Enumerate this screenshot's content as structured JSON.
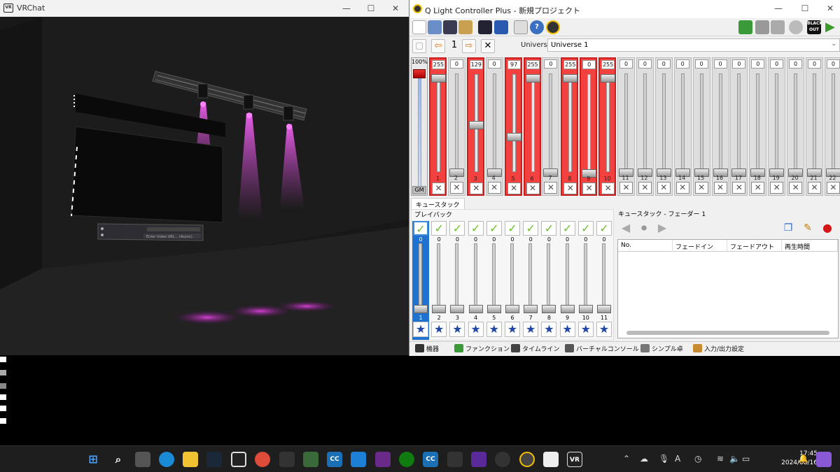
{
  "vrchat": {
    "title": "VRChat",
    "icon": "VR",
    "panel_text": "Enter Video URL... (Async)"
  },
  "qlc": {
    "title": "Q Light Controller Plus - 新規プロジェクト",
    "blackout_label": "BLACK OUT",
    "page_number": "1",
    "universe_label": "Universe",
    "universe_value": "Universe 1",
    "gm": {
      "percent": "100%",
      "label": "GM"
    },
    "channels": [
      {
        "num": "1",
        "value": "255",
        "on": true
      },
      {
        "num": "2",
        "value": "0",
        "on": false
      },
      {
        "num": "3",
        "value": "129",
        "on": true
      },
      {
        "num": "4",
        "value": "0",
        "on": false
      },
      {
        "num": "5",
        "value": "97",
        "on": true
      },
      {
        "num": "6",
        "value": "255",
        "on": true
      },
      {
        "num": "7",
        "value": "0",
        "on": false
      },
      {
        "num": "8",
        "value": "255",
        "on": true
      },
      {
        "num": "9",
        "value": "0",
        "on": true
      },
      {
        "num": "10",
        "value": "255",
        "on": true
      },
      {
        "num": "11",
        "value": "0",
        "on": false
      },
      {
        "num": "12",
        "value": "0",
        "on": false
      },
      {
        "num": "13",
        "value": "0",
        "on": false
      },
      {
        "num": "14",
        "value": "0",
        "on": false
      },
      {
        "num": "15",
        "value": "0",
        "on": false
      },
      {
        "num": "16",
        "value": "0",
        "on": false
      },
      {
        "num": "17",
        "value": "0",
        "on": false
      },
      {
        "num": "18",
        "value": "0",
        "on": false
      },
      {
        "num": "19",
        "value": "0",
        "on": false
      },
      {
        "num": "20",
        "value": "0",
        "on": false
      },
      {
        "num": "21",
        "value": "0",
        "on": false
      },
      {
        "num": "22",
        "value": "0",
        "on": false
      }
    ],
    "cue_stack_tab": "キュースタック",
    "playback_title": "プレイバック",
    "playbacks": [
      {
        "num": "1",
        "value": "0"
      },
      {
        "num": "2",
        "value": "0"
      },
      {
        "num": "3",
        "value": "0"
      },
      {
        "num": "4",
        "value": "0"
      },
      {
        "num": "5",
        "value": "0"
      },
      {
        "num": "6",
        "value": "0"
      },
      {
        "num": "7",
        "value": "0"
      },
      {
        "num": "8",
        "value": "0"
      },
      {
        "num": "9",
        "value": "0"
      },
      {
        "num": "10",
        "value": "0"
      },
      {
        "num": "11",
        "value": "0"
      }
    ],
    "cue_stack_title": "キュースタック - フェーダー 1",
    "cue_columns": [
      "No.",
      "フェードイン",
      "フェードアウト",
      "再生時間"
    ],
    "bottom_tabs": [
      "機器",
      "ファンクション",
      "タイムライン",
      "バーチャルコンソール",
      "シンプル卓",
      "入力/出力設定"
    ]
  },
  "taskbar": {
    "time": "17:45",
    "date": "2024/08/16",
    "lang": "A"
  }
}
